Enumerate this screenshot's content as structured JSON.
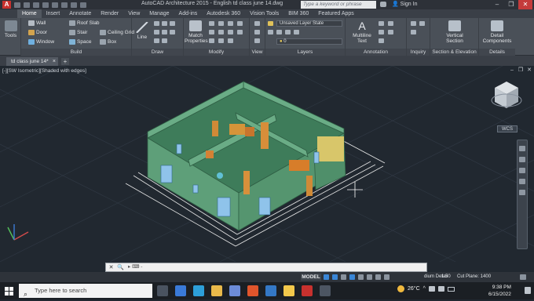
{
  "titlebar": {
    "title": "AutoCAD Architecture 2015 - English    td class june 14.dwg",
    "search_placeholder": "Type a keyword or phrase",
    "sign_in": "Sign In",
    "min": "–",
    "max": "❐",
    "close": "✕"
  },
  "tabs": [
    "Home",
    "Insert",
    "Annotate",
    "Render",
    "View",
    "Manage",
    "Add-ins",
    "Autodesk 360",
    "Vision Tools",
    "BIM 360",
    "Featured Apps"
  ],
  "ribbon": {
    "tools": "Tools",
    "build": {
      "label": "Build",
      "wall": "Wall",
      "door": "Door",
      "window": "Window",
      "roof_slab": "Roof Slab",
      "stair": "Stair",
      "space": "Space",
      "ceiling_grid": "Ceiling Grid",
      "box": "Box"
    },
    "draw": {
      "label": "Draw",
      "line": "Line"
    },
    "modify": {
      "label": "Modify",
      "match_properties": "Match Properties"
    },
    "view": {
      "label": "View"
    },
    "layers": {
      "label": "Layers",
      "layer_state": "Unsaved Layer State",
      "current_layer": "0"
    },
    "annotation": {
      "label": "Annotation",
      "multiline_text": "Multiline Text"
    },
    "inquiry": {
      "label": "Inquiry"
    },
    "section": {
      "label": "Section & Elevation",
      "vertical_section": "Vertical Section"
    },
    "details": {
      "label": "Details",
      "detail_components": "Detail Components"
    }
  },
  "file_tab": {
    "name": "td class june 14*",
    "close": "×",
    "new": "+"
  },
  "viewport": {
    "label": "[-][SW Isometric][Shaded with edges]",
    "min": "–",
    "restore": "❐",
    "close": "✕",
    "wcs": "WCS"
  },
  "command": {
    "close": "✕",
    "search": "🔍",
    "prompt": "▸ ⌨ -"
  },
  "status": {
    "model": "MODEL",
    "scale": "1:50",
    "display": "dium Detail",
    "cut_plane": "Cut Plane:  1400"
  },
  "taskbar": {
    "search_placeholder": "Type here to search",
    "weather": "26°C",
    "time": "9:38 PM",
    "date": "6/15/2022"
  },
  "colors": {
    "wall": "#5d9e78",
    "floor": "#3e7c5a",
    "accent": "#3a86d6",
    "furniture": "#d59439"
  }
}
